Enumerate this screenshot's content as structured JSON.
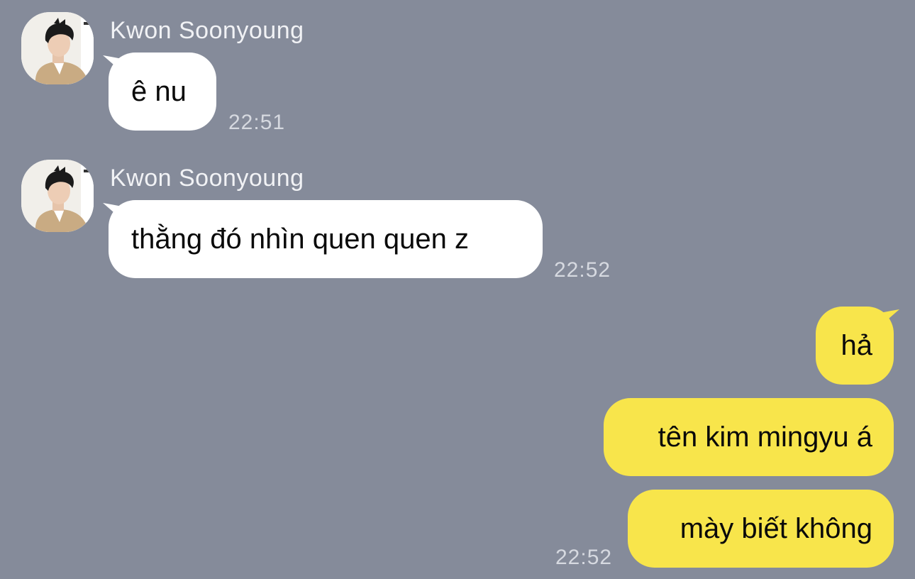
{
  "chat": {
    "messages": [
      {
        "sender": "Kwon Soonyoung",
        "text": "ê nu",
        "time": "22:51"
      },
      {
        "sender": "Kwon Soonyoung",
        "text": "thằng đó nhìn quen quen z",
        "time": "22:52"
      },
      {
        "text": "hả"
      },
      {
        "text": "tên kim mingyu á"
      },
      {
        "text": "mày biết không",
        "time": "22:52"
      }
    ]
  },
  "icons": {
    "avatar": "profile-photo-avatar"
  },
  "colors": {
    "background": "#858b9a",
    "incoming_bubble": "#ffffff",
    "outgoing_bubble": "#f8e54b"
  }
}
